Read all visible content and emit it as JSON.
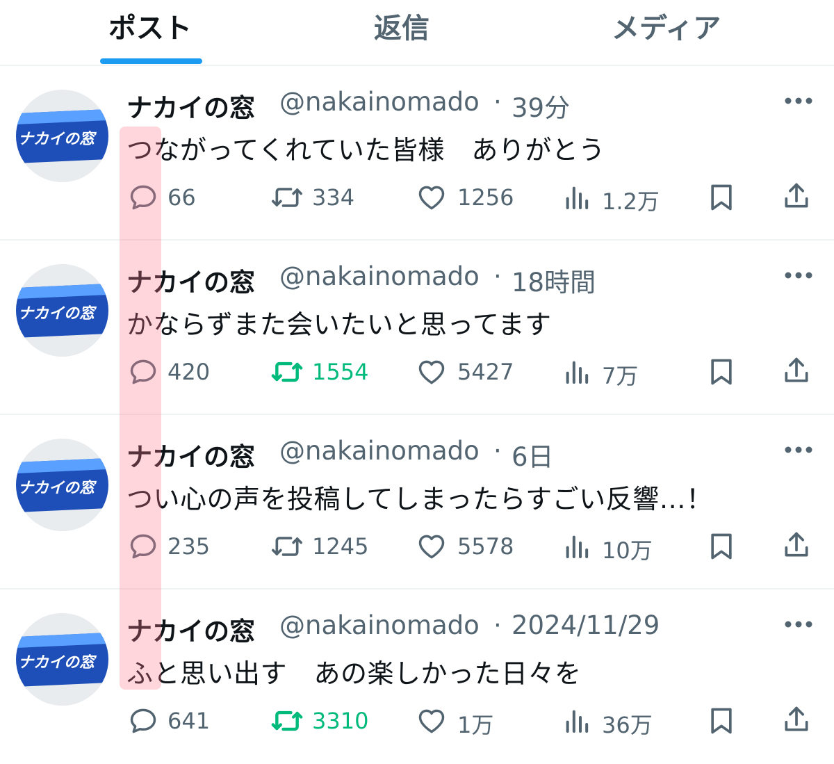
{
  "tabs": [
    {
      "label": "ポスト",
      "active": true
    },
    {
      "label": "返信",
      "active": false
    },
    {
      "label": "メディア",
      "active": false
    }
  ],
  "avatar": {
    "text": "ナカイの窓"
  },
  "posts": [
    {
      "name": "ナカイの窓",
      "handle": "@nakainomado",
      "dot": "·",
      "time": "39分",
      "text": "つながってくれていた皆様　ありがとう",
      "replies": "66",
      "reposts": "334",
      "likes": "1256",
      "views": "1.2万",
      "reposted": false
    },
    {
      "name": "ナカイの窓",
      "handle": "@nakainomado",
      "dot": "·",
      "time": "18時間",
      "text": "かならずまた会いたいと思ってます",
      "replies": "420",
      "reposts": "1554",
      "likes": "5427",
      "views": "7万",
      "reposted": true
    },
    {
      "name": "ナカイの窓",
      "handle": "@nakainomado",
      "dot": "·",
      "time": "6日",
      "text": "つい心の声を投稿してしまったらすごい反響…！",
      "replies": "235",
      "reposts": "1245",
      "likes": "5578",
      "views": "10万",
      "reposted": false
    },
    {
      "name": "ナカイの窓",
      "handle": "@nakainomado",
      "dot": "·",
      "time": "2024/11/29",
      "text": "ふと思い出す　あの楽しかった日々を",
      "replies": "641",
      "reposts": "3310",
      "likes": "1万",
      "views": "36万",
      "reposted": true
    }
  ],
  "icons": {
    "reply": "reply-icon",
    "repost": "repost-icon",
    "like": "heart-icon",
    "views": "views-icon",
    "bookmark": "bookmark-icon",
    "share": "share-icon",
    "more": "more-icon"
  },
  "colors": {
    "accent": "#1d9bf0",
    "repost_active": "#00ba7c",
    "muted": "#536471",
    "text": "#0f1419",
    "highlight": "#ffb6c1"
  }
}
